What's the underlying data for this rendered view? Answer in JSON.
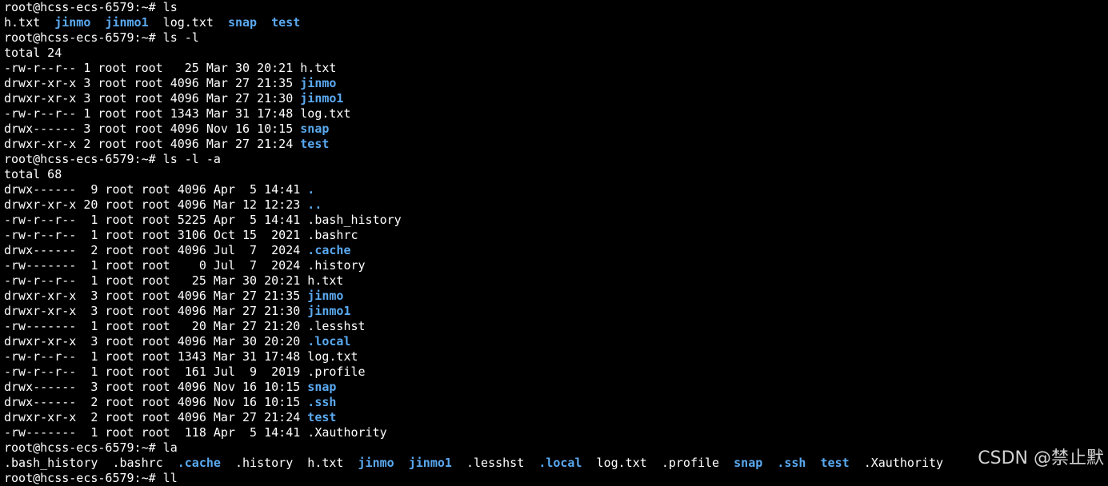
{
  "colors": {
    "background": "#000000",
    "text": "#ffffff",
    "directory": "#5aa9f0"
  },
  "terminal": {
    "lines": [
      [
        {
          "t": "root@hcss-ecs-6579:~# ls"
        }
      ],
      [
        {
          "t": "h.txt  "
        },
        {
          "t": "jinmo",
          "dir": true
        },
        {
          "t": "  "
        },
        {
          "t": "jinmo1",
          "dir": true
        },
        {
          "t": "  log.txt  "
        },
        {
          "t": "snap",
          "dir": true
        },
        {
          "t": "  "
        },
        {
          "t": "test",
          "dir": true
        }
      ],
      [
        {
          "t": "root@hcss-ecs-6579:~# ls -l"
        }
      ],
      [
        {
          "t": "total 24"
        }
      ],
      [
        {
          "t": "-rw-r--r-- 1 root root   25 Mar 30 20:21 h.txt"
        }
      ],
      [
        {
          "t": "drwxr-xr-x 3 root root 4096 Mar 27 21:35 "
        },
        {
          "t": "jinmo",
          "dir": true
        }
      ],
      [
        {
          "t": "drwxr-xr-x 3 root root 4096 Mar 27 21:30 "
        },
        {
          "t": "jinmo1",
          "dir": true
        }
      ],
      [
        {
          "t": "-rw-r--r-- 1 root root 1343 Mar 31 17:48 log.txt"
        }
      ],
      [
        {
          "t": "drwx------ 3 root root 4096 Nov 16 10:15 "
        },
        {
          "t": "snap",
          "dir": true
        }
      ],
      [
        {
          "t": "drwxr-xr-x 2 root root 4096 Mar 27 21:24 "
        },
        {
          "t": "test",
          "dir": true
        }
      ],
      [
        {
          "t": "root@hcss-ecs-6579:~# ls -l -a"
        }
      ],
      [
        {
          "t": "total 68"
        }
      ],
      [
        {
          "t": "drwx------  9 root root 4096 Apr  5 14:41 "
        },
        {
          "t": ".",
          "dir": true
        }
      ],
      [
        {
          "t": "drwxr-xr-x 20 root root 4096 Mar 12 12:23 "
        },
        {
          "t": "..",
          "dir": true
        }
      ],
      [
        {
          "t": "-rw-r--r--  1 root root 5225 Apr  5 14:41 .bash_history"
        }
      ],
      [
        {
          "t": "-rw-r--r--  1 root root 3106 Oct 15  2021 .bashrc"
        }
      ],
      [
        {
          "t": "drwx------  2 root root 4096 Jul  7  2024 "
        },
        {
          "t": ".cache",
          "dir": true
        }
      ],
      [
        {
          "t": "-rw-------  1 root root    0 Jul  7  2024 .history"
        }
      ],
      [
        {
          "t": "-rw-r--r--  1 root root   25 Mar 30 20:21 h.txt"
        }
      ],
      [
        {
          "t": "drwxr-xr-x  3 root root 4096 Mar 27 21:35 "
        },
        {
          "t": "jinmo",
          "dir": true
        }
      ],
      [
        {
          "t": "drwxr-xr-x  3 root root 4096 Mar 27 21:30 "
        },
        {
          "t": "jinmo1",
          "dir": true
        }
      ],
      [
        {
          "t": "-rw-------  1 root root   20 Mar 27 21:20 .lesshst"
        }
      ],
      [
        {
          "t": "drwxr-xr-x  3 root root 4096 Mar 30 20:20 "
        },
        {
          "t": ".local",
          "dir": true
        }
      ],
      [
        {
          "t": "-rw-r--r--  1 root root 1343 Mar 31 17:48 log.txt"
        }
      ],
      [
        {
          "t": "-rw-r--r--  1 root root  161 Jul  9  2019 .profile"
        }
      ],
      [
        {
          "t": "drwx------  3 root root 4096 Nov 16 10:15 "
        },
        {
          "t": "snap",
          "dir": true
        }
      ],
      [
        {
          "t": "drwx------  2 root root 4096 Nov 16 10:15 "
        },
        {
          "t": ".ssh",
          "dir": true
        }
      ],
      [
        {
          "t": "drwxr-xr-x  2 root root 4096 Mar 27 21:24 "
        },
        {
          "t": "test",
          "dir": true
        }
      ],
      [
        {
          "t": "-rw-------  1 root root  118 Apr  5 14:41 .Xauthority"
        }
      ],
      [
        {
          "t": "root@hcss-ecs-6579:~# la"
        }
      ],
      [
        {
          "t": ".bash_history  .bashrc  "
        },
        {
          "t": ".cache",
          "dir": true
        },
        {
          "t": "  .history  h.txt  "
        },
        {
          "t": "jinmo",
          "dir": true
        },
        {
          "t": "  "
        },
        {
          "t": "jinmo1",
          "dir": true
        },
        {
          "t": "  .lesshst  "
        },
        {
          "t": ".local",
          "dir": true
        },
        {
          "t": "  log.txt  .profile  "
        },
        {
          "t": "snap",
          "dir": true
        },
        {
          "t": "  "
        },
        {
          "t": ".ssh",
          "dir": true
        },
        {
          "t": "  "
        },
        {
          "t": "test",
          "dir": true
        },
        {
          "t": "  .Xauthority"
        }
      ],
      [
        {
          "t": "root@hcss-ecs-6579:~# ll"
        }
      ]
    ]
  },
  "watermark": {
    "text": "CSDN @禁止默"
  }
}
